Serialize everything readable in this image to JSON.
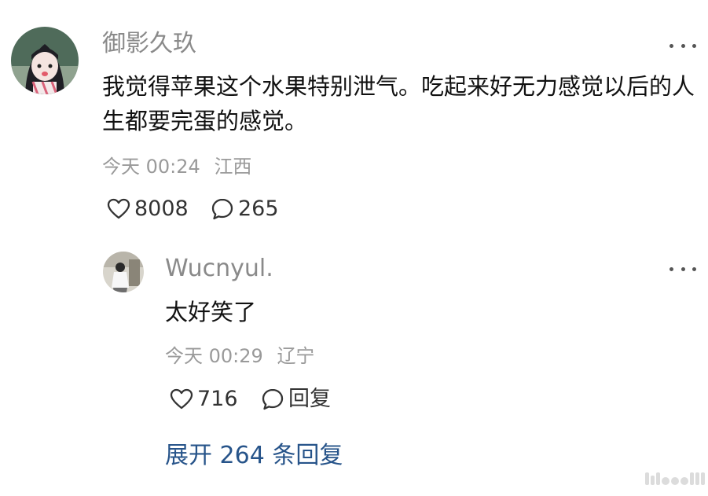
{
  "comment": {
    "username": "御影久玖",
    "text": "我觉得苹果这个水果特别泄气。吃起来好无力感觉以后的人生都要完蛋的感觉。",
    "time": "今天 00:24",
    "location": "江西",
    "likes": "8008",
    "replies": "265",
    "more_icon": "more-horizontal-icon"
  },
  "reply": {
    "username": "Wucnyul.",
    "text": "太好笑了",
    "time": "今天 00:29",
    "location": "辽宁",
    "likes": "716",
    "reply_label": "回复",
    "more_icon": "more-horizontal-icon"
  },
  "expand_label": "展开 264 条回复",
  "colors": {
    "username": "#8a8a8a",
    "meta": "#9a9a9a",
    "link": "#27548a",
    "text": "#111111"
  }
}
